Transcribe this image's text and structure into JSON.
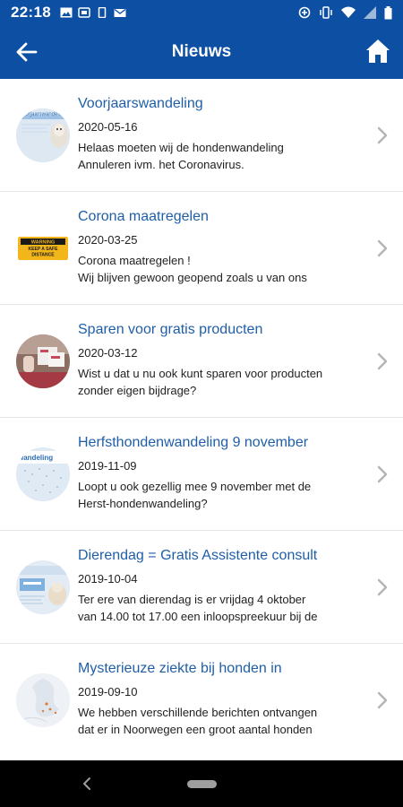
{
  "status_bar": {
    "time": "22:18"
  },
  "app_bar": {
    "title": "Nieuws"
  },
  "news": [
    {
      "title": "Voorjaarswandeling",
      "date": "2020-05-16",
      "body": [
        "Helaas moeten wij de hondenwandeling",
        "Annuleren ivm. het Coronavirus."
      ],
      "thumb_text": "voorjaarswandeling"
    },
    {
      "title": "Corona maatregelen",
      "date": "2020-03-25",
      "body": [
        "Corona maatregelen !",
        "Wij blijven gewoon geopend zoals u van ons"
      ],
      "thumb_text": [
        "WARNING",
        "KEEP A SAFE",
        "DISTANCE"
      ]
    },
    {
      "title": "Sparen voor gratis producten",
      "date": "2020-03-12",
      "body": [
        "Wist u dat u nu ook kunt sparen voor producten",
        "zonder eigen bijdrage?"
      ]
    },
    {
      "title": "Herfsthondenwandeling 9 november",
      "date": "2019-11-09",
      "body": [
        "Loopt u ook gezellig mee 9 november met de",
        "Herst-hondenwandeling?"
      ],
      "thumb_text": "wandeling"
    },
    {
      "title": "Dierendag = Gratis Assistente consult",
      "date": "2019-10-04",
      "body": [
        "Ter ere van dierendag is er vrijdag 4 oktober",
        "van 14.00 tot 17.00 een inloopspreekuur bij de"
      ]
    },
    {
      "title": "Mysterieuze ziekte bij honden in",
      "date": "2019-09-10",
      "body": [
        "We hebben verschillende berichten ontvangen",
        "dat er in Noorwegen een groot aantal honden"
      ]
    }
  ],
  "colors": {
    "primary": "#0d4fa3",
    "title_text": "#1f5ea8",
    "warning_yellow": "#f2b51a"
  },
  "icons": {
    "back": "arrow-left-icon",
    "home": "home-icon",
    "chevron": "chevron-right-icon"
  }
}
